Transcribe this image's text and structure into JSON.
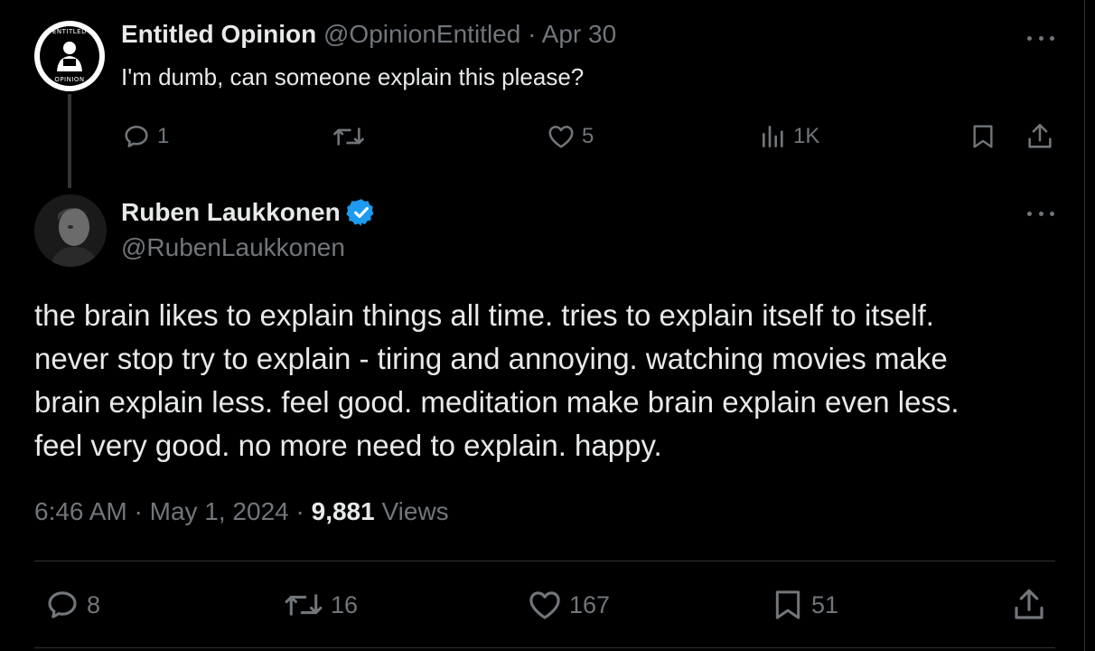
{
  "parent_tweet": {
    "author_name": "Entitled Opinion",
    "handle": "@OpinionEntitled",
    "separator": "·",
    "date": "Apr 30",
    "avatar_text_top": "ENTITLED",
    "avatar_text_bottom": "OPINION",
    "text": "I'm dumb, can someone explain this please?",
    "actions": {
      "replies": "1",
      "reposts": "",
      "likes": "5",
      "views": "1K"
    },
    "icons": [
      "reply-icon",
      "repost-icon",
      "like-icon",
      "views-icon",
      "bookmark-icon",
      "share-icon",
      "more-icon"
    ]
  },
  "main_tweet": {
    "author_name": "Ruben Laukkonen",
    "handle": "@RubenLaukkonen",
    "verified": true,
    "text_lines": [
      "the brain likes to explain things all time. tries to explain itself to itself.",
      "never stop try to explain - tiring and annoying. watching movies make",
      "brain explain less. feel good. meditation make brain explain even less.",
      "feel very good. no more need to explain. happy."
    ],
    "time": "6:46 AM",
    "separator": "·",
    "date": "May 1, 2024",
    "views_count": "9,881",
    "views_label": "Views",
    "actions": {
      "replies": "8",
      "reposts": "16",
      "likes": "167",
      "bookmarks": "51"
    }
  },
  "colors": {
    "background": "#000000",
    "text_primary": "#e7e9ea",
    "text_secondary": "#71767b",
    "verified_blue": "#1d9bf0",
    "divider": "#2f3336"
  }
}
